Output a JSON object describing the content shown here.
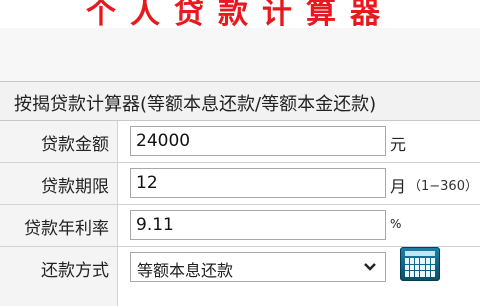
{
  "banner": {
    "title": "个人贷款计算器"
  },
  "header": {
    "title": "按揭贷款计算器(等额本息还款/等额本金还款)"
  },
  "form": {
    "amount": {
      "label": "贷款金额",
      "value": "24000",
      "unit": "元"
    },
    "term": {
      "label": "贷款期限",
      "value": "12",
      "unit": "月",
      "hint": "（1−360）"
    },
    "rate": {
      "label": "贷款年利率",
      "value": "9.11",
      "unit": "%"
    },
    "method": {
      "label": "还款方式",
      "selected": "等额本息还款"
    }
  },
  "icons": {
    "calculator": "calculator-icon",
    "chevron": "chevron-down-icon"
  },
  "colors": {
    "banner_title": "#e8191e",
    "calculator": "#0b4f6b"
  }
}
